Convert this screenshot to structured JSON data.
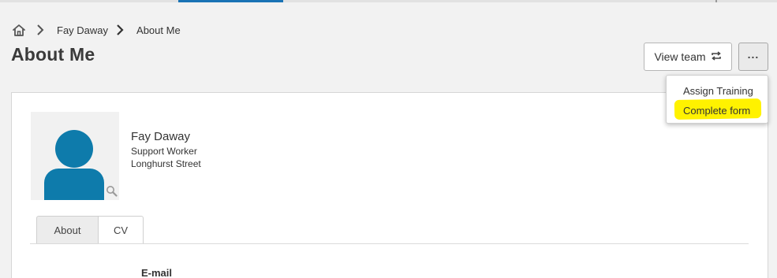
{
  "breadcrumb": {
    "home_icon": "home-icon",
    "items": [
      "Fay Daway",
      "About Me"
    ]
  },
  "page": {
    "title": "About Me"
  },
  "header_actions": {
    "view_team_label": "View team",
    "view_team_icon": "swap-icon",
    "more_icon": "more-dots-icon",
    "more_glyph": "..."
  },
  "dropdown": {
    "items": [
      {
        "label": "Assign Training"
      },
      {
        "label": "Complete form",
        "highlighted": true
      }
    ],
    "highlight_color": "#fff200"
  },
  "profile": {
    "name": "Fay Daway",
    "role": "Support Worker",
    "location": "Longhurst Street",
    "avatar_color": "#0e7bab"
  },
  "tabs": [
    {
      "label": "About",
      "active": true
    },
    {
      "label": "CV",
      "active": false
    }
  ],
  "about": {
    "email_label": "E-mail"
  },
  "colors": {
    "accent": "#1a73b5",
    "page_bg": "#f2f2f2"
  }
}
